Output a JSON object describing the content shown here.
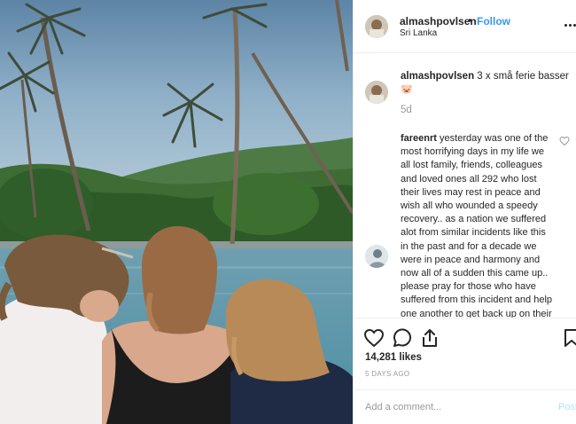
{
  "post": {
    "username": "almashpovlsen",
    "separator": "•",
    "follow_label": "Follow",
    "location": "Sri Lanka",
    "more_icon": "more-options-icon"
  },
  "caption": {
    "username": "almashpovlsen",
    "text": "3 x små ferie basser",
    "emoji": "🐷",
    "time": "5d"
  },
  "comment": {
    "username": "fareenrt",
    "text": "yesterday was one of the most horrifying days in my life we all lost family, friends, colleagues and loved ones all 292 who lost their lives may rest in peace and wish all who wounded a speedy recovery.. as a nation we suffered alot from similar incidents like this in the past and for a decade we were in peace and harmony and now all of a sudden this came up.. please pray for those who have suffered from this incident and help one another to get back up on their feet"
  },
  "actions": {
    "likes": "14,281 likes",
    "timeago": "5 DAYS AGO",
    "icons": [
      "heart-icon",
      "comment-icon",
      "share-icon",
      "bookmark-icon"
    ]
  },
  "add_comment": {
    "placeholder": "Add a comment...",
    "post_label": "Post"
  },
  "colors": {
    "link_blue": "#3897f0",
    "post_disabled": "#b2dffc",
    "muted": "#999999",
    "text": "#262626"
  }
}
